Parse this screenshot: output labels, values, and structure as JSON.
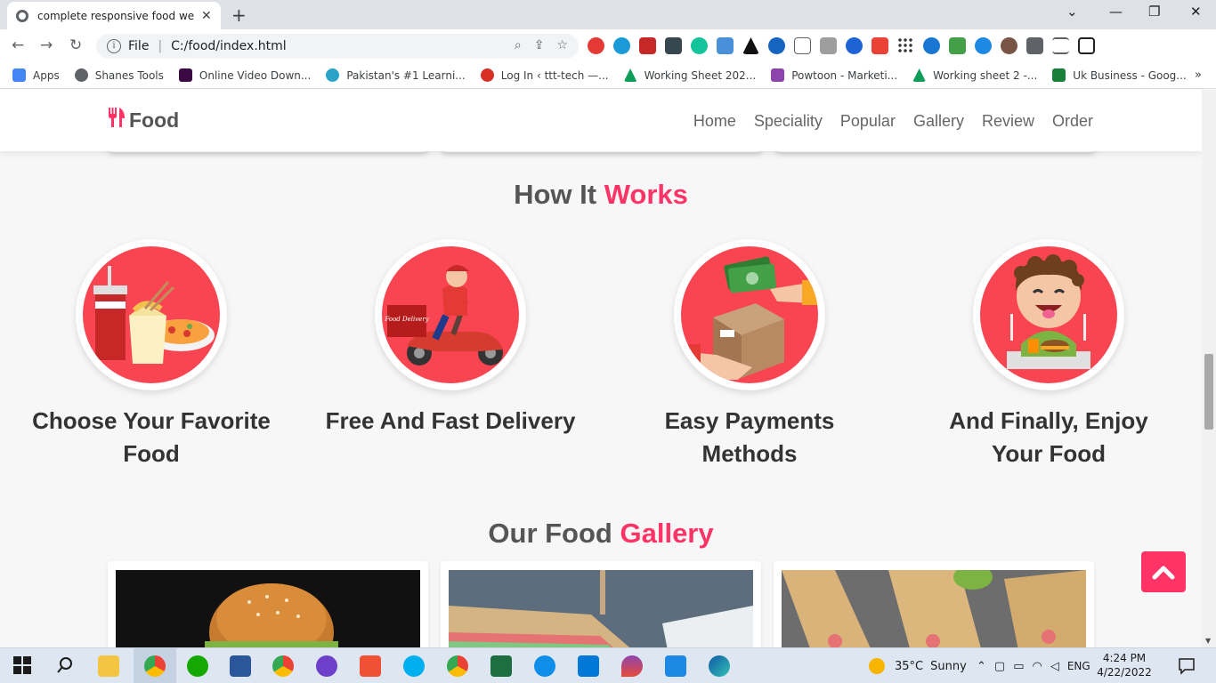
{
  "browser": {
    "tab_title": "complete responsive food websit",
    "new_tab_symbol": "+",
    "url_scheme_label": "File",
    "url": "C:/food/index.html",
    "bookmarks": [
      {
        "label": "Apps",
        "color": "#4285f4"
      },
      {
        "label": "Shanes Tools",
        "color": "#5f6368"
      },
      {
        "label": "Online Video Down...",
        "color": "#3b0a45"
      },
      {
        "label": "Pakistan's #1 Learni...",
        "color": "#29a3c7"
      },
      {
        "label": "Log In ‹ ttt-tech —...",
        "color": "#d93025"
      },
      {
        "label": "Working Sheet 202...",
        "color": "#0f9d58"
      },
      {
        "label": "Powtoon - Marketi...",
        "color": "#8e44ad"
      },
      {
        "label": "Working sheet 2 -...",
        "color": "#0f9d58"
      },
      {
        "label": "Uk Business - Goog...",
        "color": "#188038"
      }
    ],
    "bookmarks_more": "»"
  },
  "site": {
    "logo_text": "Food",
    "nav": [
      "Home",
      "Speciality",
      "Popular",
      "Gallery",
      "Review",
      "Order"
    ],
    "how_it_works": {
      "title_plain": "How It ",
      "title_accent": "Works"
    },
    "steps": [
      {
        "line1": "Choose Your Favorite",
        "line2": "Food"
      },
      {
        "line1": "Free And Fast Delivery",
        "line2": ""
      },
      {
        "line1": "Easy Payments",
        "line2": "Methods"
      },
      {
        "line1": "And Finally, Enjoy",
        "line2": "Your Food"
      }
    ],
    "gallery": {
      "title_plain": "Our Food ",
      "title_accent": "Gallery"
    },
    "scooter_text": "Food Delivery",
    "colors": {
      "accent": "#ff3366",
      "circle": "#f94452",
      "heading": "#555555"
    }
  },
  "taskbar": {
    "weather_temp": "35°C",
    "weather_desc": "Sunny",
    "language": "ENG",
    "time": "4:24 PM",
    "date": "4/22/2022"
  }
}
